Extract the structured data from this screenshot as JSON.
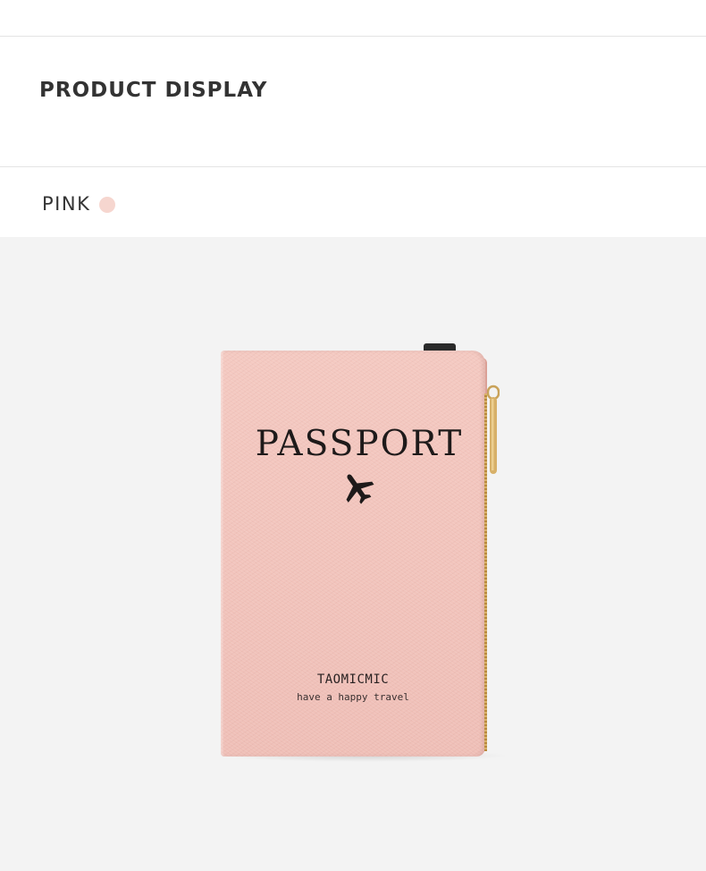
{
  "section": {
    "title": "PRODUCT DISPLAY"
  },
  "color_option": {
    "name": "PINK",
    "swatch_color": "#f6d6cf"
  },
  "product": {
    "cover_title": "PASSPORT",
    "emblem_icon": "airplane-icon",
    "brand": "TAOMICMIC",
    "tagline": "have a happy travel",
    "cover_color": "#f2c4bc",
    "background_color": "#f3f3f3"
  }
}
